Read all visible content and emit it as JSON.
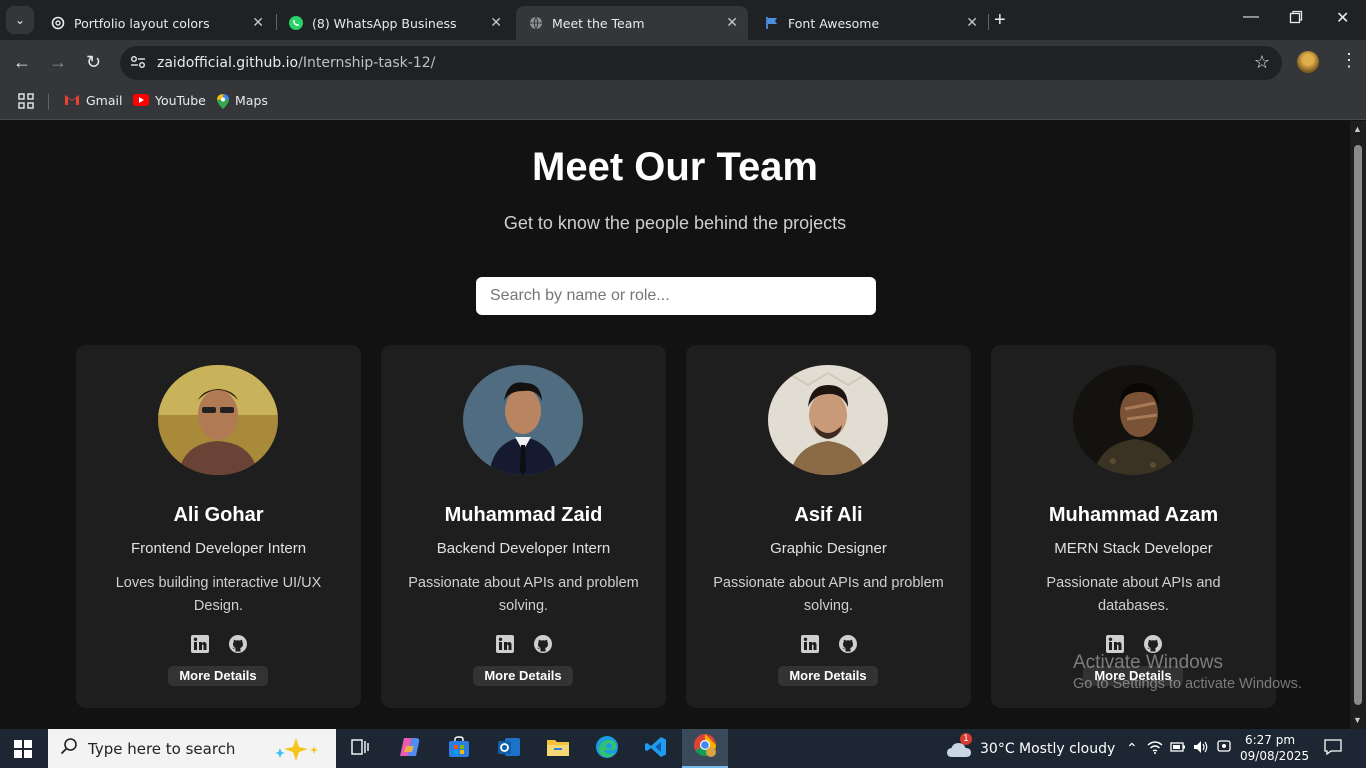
{
  "browser": {
    "tabs": [
      {
        "title": "Portfolio layout colors",
        "icon": "openai-icon",
        "active": false
      },
      {
        "title": "(8) WhatsApp Business",
        "icon": "whatsapp-icon",
        "active": false
      },
      {
        "title": "Meet the Team",
        "icon": "globe-icon",
        "active": true
      },
      {
        "title": "Font Awesome",
        "icon": "flag-icon",
        "active": false
      }
    ],
    "url_host": "zaidofficial.github.io",
    "url_path": "/Internship-task-12/",
    "bookmarks": [
      {
        "label": "Gmail",
        "icon": "gmail-icon"
      },
      {
        "label": "YouTube",
        "icon": "youtube-icon"
      },
      {
        "label": "Maps",
        "icon": "maps-icon"
      }
    ]
  },
  "page": {
    "title": "Meet Our Team",
    "subtitle": "Get to know the people behind the projects",
    "search_placeholder": "Search by name or role...",
    "more_label": "More Details",
    "members": [
      {
        "name": "Ali Gohar",
        "role": "Frontend Developer Intern",
        "desc": "Loves building interactive UI/UX Design."
      },
      {
        "name": "Muhammad Zaid",
        "role": "Backend Developer Intern",
        "desc": "Passionate about APIs and problem solving."
      },
      {
        "name": "Asif Ali",
        "role": "Graphic Designer",
        "desc": "Passionate about APIs and problem solving."
      },
      {
        "name": "Muhammad Azam",
        "role": "MERN Stack Developer",
        "desc": "Passionate about APIs and databases."
      }
    ]
  },
  "watermark": {
    "line1": "Activate Windows",
    "line2": "Go to Settings to activate Windows."
  },
  "taskbar": {
    "search_placeholder": "Type here to search",
    "weather": "30°C  Mostly cloudy",
    "weather_badge": "1",
    "time": "6:27 pm",
    "date": "09/08/2025"
  }
}
